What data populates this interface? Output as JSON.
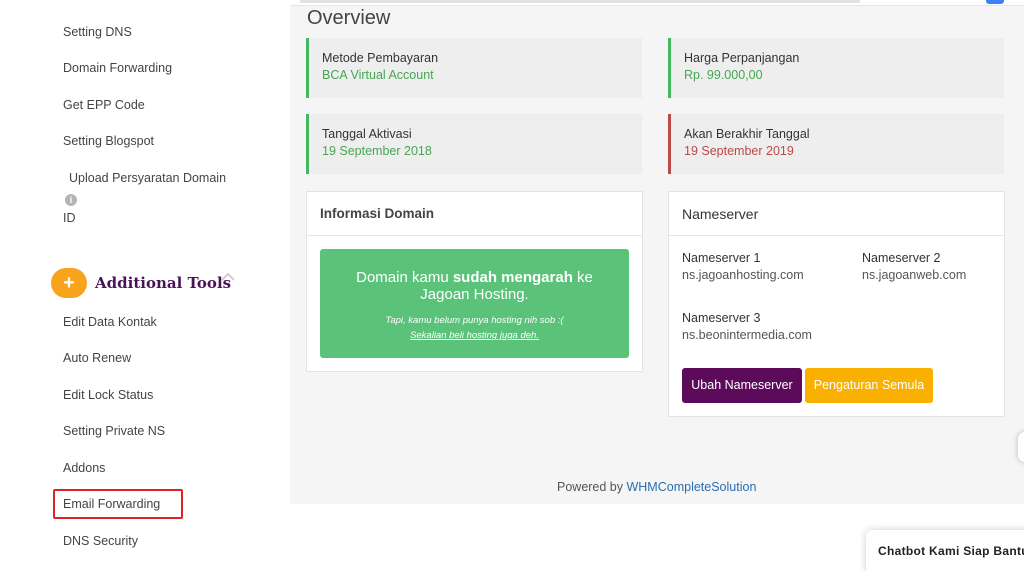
{
  "sidebar": {
    "items_top": [
      "Setting DNS",
      "Domain Forwarding",
      "Get EPP Code",
      "Setting Blogspot"
    ],
    "upload_line1": "Upload Persyaratan Domain",
    "upload_line2": "ID",
    "info_glyph": "i",
    "tools_plus": "+",
    "tools_title": "Additional Tools",
    "tools_items": [
      "Edit Data Kontak",
      "Auto Renew",
      "Edit Lock Status",
      "Setting Private NS",
      "Addons",
      "Email Forwarding",
      "DNS Security"
    ]
  },
  "main": {
    "title": "Overview",
    "cards": [
      {
        "label": "Metode Pembayaran",
        "value": "BCA Virtual Account",
        "status_color": "#46b75e"
      },
      {
        "label": "Harga Perpanjangan",
        "value": "Rp. 99.000,00",
        "status_color": "#46b75e"
      },
      {
        "label": "Tanggal Aktivasi",
        "value": "19 September 2018",
        "status_color": "#46b75e"
      },
      {
        "label": "Akan Berakhir Tanggal",
        "value": "19 September 2019",
        "status_color": "#b94a48"
      }
    ],
    "info_domain": {
      "title": "Informasi Domain",
      "msg_pre": "Domain kamu ",
      "msg_bold": "sudah mengarah",
      "msg_post": " ke Jagoan Hosting.",
      "sub": "Tapi, kamu belum punya hosting nih sob :(",
      "link": "Sekalian beli hosting juga deh."
    },
    "nameserver": {
      "title": "Nameserver",
      "entries": [
        {
          "label": "Nameserver 1",
          "value": "ns.jagoanhosting.com"
        },
        {
          "label": "Nameserver 2",
          "value": "ns.jagoanweb.com"
        },
        {
          "label": "Nameserver 3",
          "value": "ns.beonintermedia.com"
        }
      ],
      "change_button": "Ubah Nameserver",
      "reset_button": "Pengaturan Semula"
    },
    "footer_prefix": "Powered by ",
    "footer_link": "WHMCompleteSolution"
  },
  "chatbot": {
    "label": "Chatbot Kami Siap Bantu"
  },
  "colors": {
    "accent_purple": "#5c0b5a",
    "accent_yellow": "#f9b000",
    "success_green": "#46b75e",
    "danger_red": "#b94a48"
  }
}
